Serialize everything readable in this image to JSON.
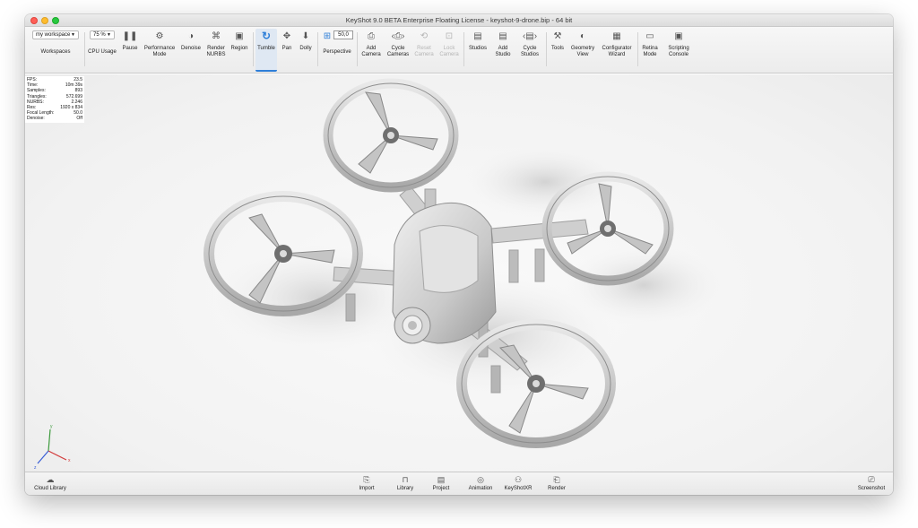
{
  "window": {
    "title": "KeyShot 9.0 BETA Enterprise Floating License  - keyshot-9-drone.bip  - 64 bit"
  },
  "toolbar": {
    "workspace_value": "my workspace",
    "workspaces_label": "Workspaces",
    "cpu_value": "75 %",
    "cpu_label": "CPU Usage",
    "pause_label": "Pause",
    "performance_label": "Performance\nMode",
    "denoise_label": "Denoise",
    "render_nurbs_label": "Render\nNURBS",
    "region_label": "Region",
    "tumble_label": "Tumble",
    "pan_label": "Pan",
    "dolly_label": "Dolly",
    "perspective_value": "50,0",
    "perspective_label": "Perspective",
    "add_camera_label": "Add\nCamera",
    "cycle_cameras_label": "Cycle\nCameras",
    "reset_camera_label": "Reset\nCamera",
    "lock_camera_label": "Lock\nCamera",
    "studios_label": "Studios",
    "add_studio_label": "Add\nStudio",
    "cycle_studios_label": "Cycle\nStudios",
    "tools_label": "Tools",
    "geometry_view_label": "Geometry\nView",
    "configurator_wizard_label": "Configurator\nWizard",
    "retina_mode_label": "Retina\nMode",
    "scripting_console_label": "Scripting\nConsole"
  },
  "hud": {
    "rows": [
      {
        "label": "FPS:",
        "value": "23.5"
      },
      {
        "label": "Time:",
        "value": "10m 39s"
      },
      {
        "label": "Samples:",
        "value": "893"
      },
      {
        "label": "Triangles:",
        "value": "572.699"
      },
      {
        "label": "NURBS:",
        "value": "2.246"
      },
      {
        "label": "Res:",
        "value": "1920 x 834"
      },
      {
        "label": "Focal Length:",
        "value": "50.0"
      },
      {
        "label": "Denoise:",
        "value": "Off"
      }
    ]
  },
  "axes": {
    "x": "x",
    "y": "y",
    "z": "z"
  },
  "bottombar": {
    "cloud_library": "Cloud Library",
    "import": "Import",
    "library": "Library",
    "project": "Project",
    "animation": "Animation",
    "keyshotxr": "KeyShotXR",
    "render": "Render",
    "screenshot": "Screenshot"
  }
}
